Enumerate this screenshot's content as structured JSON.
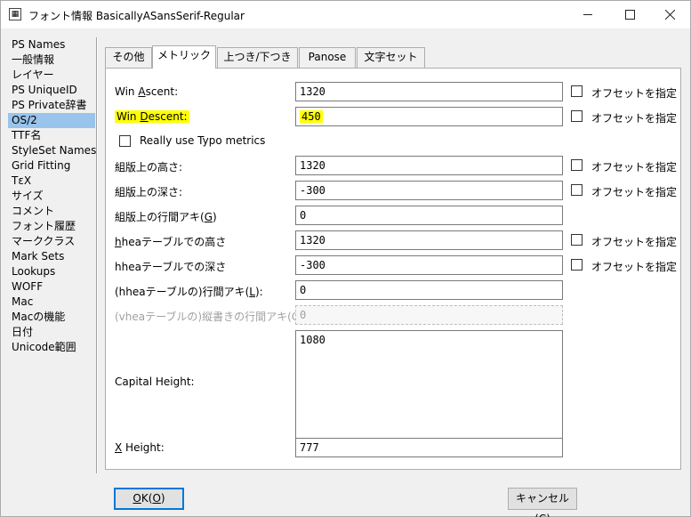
{
  "window": {
    "title": "フォント情報 BasicallyASansSerif-Regular",
    "controls": {
      "minimize": "—",
      "maximize": "☐",
      "close": "✕"
    }
  },
  "sidebar": {
    "items": [
      {
        "label": "PS Names"
      },
      {
        "label": "一般情報"
      },
      {
        "label": "レイヤー"
      },
      {
        "label": "PS UniqueID"
      },
      {
        "label": "PS Private辞書"
      },
      {
        "label": "OS/2",
        "selected": true
      },
      {
        "label": "TTF名"
      },
      {
        "label": "StyleSet Names"
      },
      {
        "label": "Grid Fitting"
      },
      {
        "label": "TεX"
      },
      {
        "label": "サイズ"
      },
      {
        "label": "コメント"
      },
      {
        "label": "フォント履歴"
      },
      {
        "label": "マーククラス"
      },
      {
        "label": "Mark Sets"
      },
      {
        "label": "Lookups"
      },
      {
        "label": "WOFF"
      },
      {
        "label": "Mac"
      },
      {
        "label": "Macの機能"
      },
      {
        "label": "日付"
      },
      {
        "label": "Unicode範囲"
      }
    ]
  },
  "tabs": [
    {
      "label": "その他"
    },
    {
      "label": "メトリック",
      "active": true
    },
    {
      "label": "上つき/下つき"
    },
    {
      "label": "Panose"
    },
    {
      "label": "文字セット"
    }
  ],
  "metrics": {
    "win_ascent": {
      "label_a": "Win ",
      "label_u": "A",
      "label_b": "scent:",
      "value": "1320",
      "offset_label": "オフセットを指定"
    },
    "win_descent": {
      "label_a": "Win ",
      "label_u": "D",
      "label_b": "escent:",
      "value": "450",
      "offset_label": "オフセットを指定"
    },
    "typo_checkbox": {
      "label": "Really use Typo metrics"
    },
    "typo_ascent": {
      "label": "組版上の高さ:",
      "value": "1320",
      "offset_label": "オフセットを指定"
    },
    "typo_descent": {
      "label": "組版上の深さ:",
      "value": "-300",
      "offset_label": "オフセットを指定"
    },
    "typo_linegap": {
      "label_a": "組版上の行間アキ(",
      "label_u": "G",
      "label_b": ")",
      "value": "0"
    },
    "hhea_ascent": {
      "label_u": "h",
      "label_b": "heaテーブルでの高さ",
      "value": "1320",
      "offset_label": "オフセットを指定"
    },
    "hhea_descent": {
      "label": "hheaテーブルでの深さ",
      "value": "-300",
      "offset_label": "オフセットを指定"
    },
    "hhea_linegap": {
      "label_a": "(hheaテーブルの)行間アキ(",
      "label_u": "L",
      "label_b": "):",
      "value": "0"
    },
    "vhea_linegap": {
      "label": "(vheaテーブルの)縦書きの行間アキ(C):",
      "value": "0"
    },
    "capital_height": {
      "label": "Capital Height:",
      "value": "1080"
    },
    "x_height": {
      "label_u": "X",
      "label_b": " Height:",
      "value": "777"
    }
  },
  "buttons": {
    "ok": {
      "label_u": "O",
      "label_a": "K(",
      "label_u2": "O",
      "label_b": ")"
    },
    "cancel": {
      "label_a": "キャンセル(",
      "label_u": "C",
      "label_b": ")"
    }
  }
}
